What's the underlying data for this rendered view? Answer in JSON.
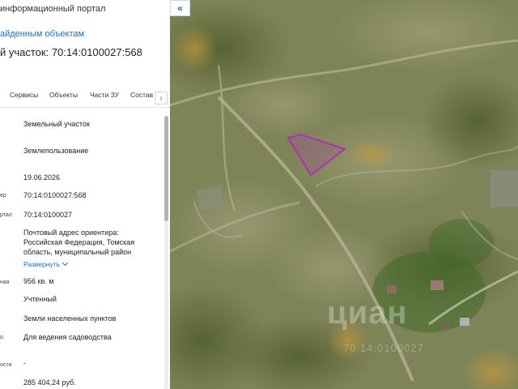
{
  "panel": {
    "portal_title": "информационный портал",
    "back_link": "айденным объектам",
    "parcel_title": "й участок: 70:14:0100027:568",
    "tabs": [
      "Сервисы",
      "Объекты",
      "Части ЗУ",
      "Состав"
    ],
    "tab_more": "›",
    "rows": [
      {
        "label": "",
        "value": "Земельный участок"
      },
      {
        "label": "",
        "value": "Землепользование"
      },
      {
        "label": "",
        "value": "19.06.2026"
      },
      {
        "label": "ер",
        "value": "70:14:0100027:568"
      },
      {
        "label": "ртал",
        "value": "70:14:0100027"
      },
      {
        "label": "",
        "value": "Почтовый адрес ориентира: Российская Федерация, Томская область, муниципальный район"
      },
      {
        "label": "",
        "value": "Развернуть"
      },
      {
        "label": "ная",
        "value": "956 кв. м"
      },
      {
        "label": "",
        "value": "Учтенный"
      },
      {
        "label": "",
        "value": "Земли населенных пунктов"
      },
      {
        "label": "о",
        "value": "Для ведения садоводства"
      },
      {
        "label": "ости",
        "value": "-"
      },
      {
        "label": "",
        "value": "285 404,24 руб."
      }
    ]
  },
  "map": {
    "collapse_label": "«",
    "watermark": "циан",
    "watermark_small": "70:14:0100027",
    "parcel_color": "#b02fb6"
  }
}
